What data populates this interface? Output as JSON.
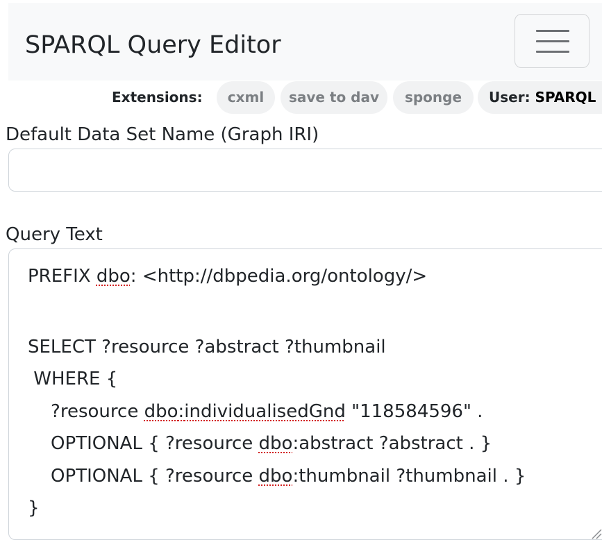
{
  "navbar": {
    "brand": "SPARQL Query Editor",
    "toggler_icon": "hamburger-menu-icon"
  },
  "extensions": {
    "label": "Extensions:",
    "items": [
      "cxml",
      "save to dav",
      "sponge"
    ],
    "user_label": "User:",
    "user_name": "SPARQL"
  },
  "graph": {
    "label": "Default Data Set Name (Graph IRI)",
    "value": ""
  },
  "query": {
    "label": "Query Text",
    "lines": {
      "l1_pre": "PREFIX ",
      "l1_dbo": "dbo",
      "l1_post": ": <http://dbpedia.org/ontology/>",
      "l2": "SELECT ?resource ?abstract ?thumbnail",
      "l3": " WHERE {",
      "l4_pre": "    ?resource ",
      "l4_dbo": "dbo",
      "l4_colon": ":",
      "l4_prop": "individualisedGnd",
      "l4_post": " \"118584596\" .",
      "l5_pre": "    OPTIONAL { ?resource ",
      "l5_dbo": "dbo",
      "l5_post": ":abstract ?abstract . }",
      "l6_pre": "    OPTIONAL { ?resource ",
      "l6_dbo": "dbo",
      "l6_post": ":thumbnail ?thumbnail . }",
      "l7": "}"
    }
  }
}
